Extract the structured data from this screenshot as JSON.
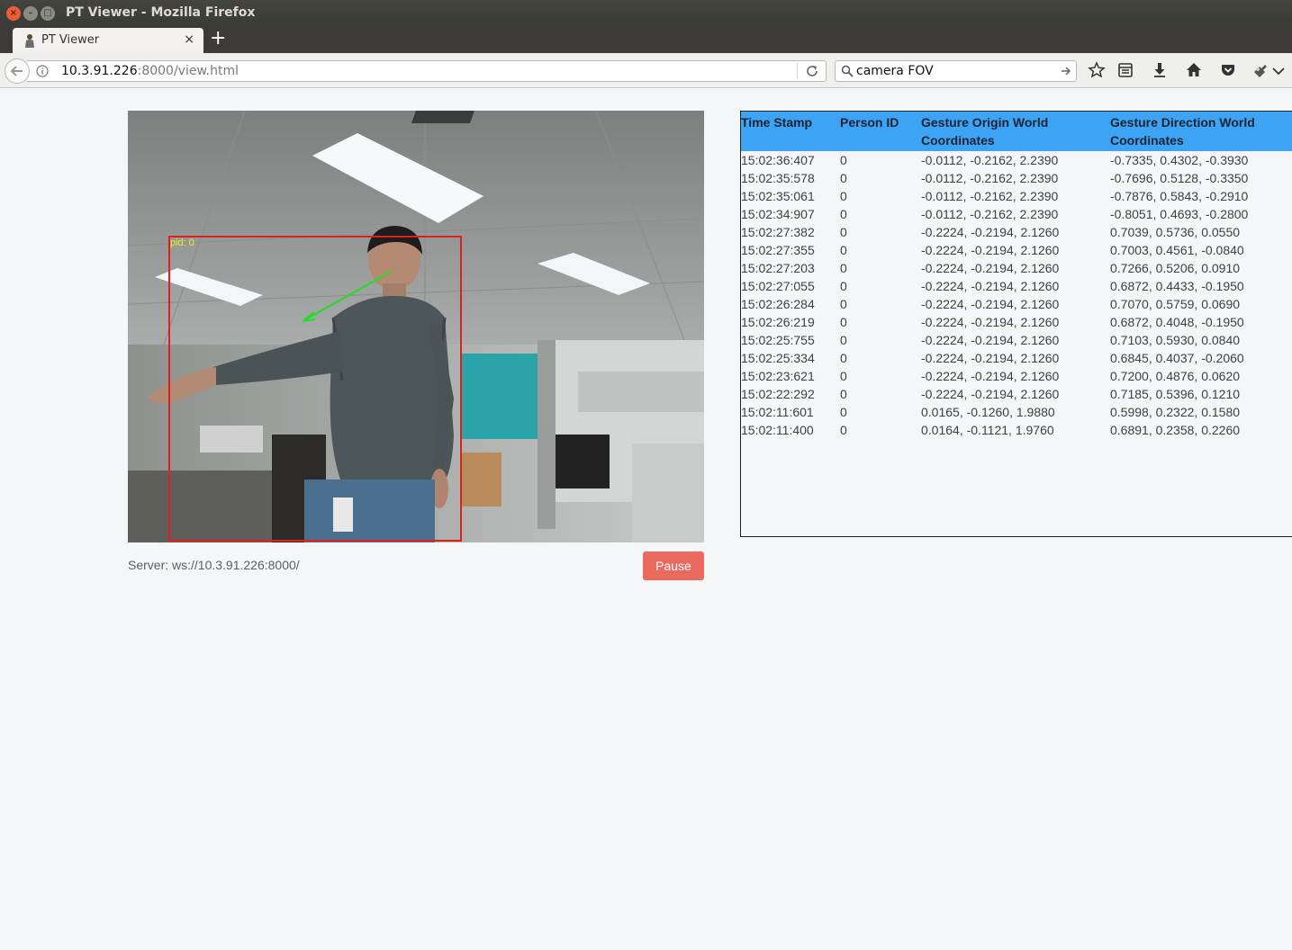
{
  "window": {
    "title": "PT Viewer - Mozilla Firefox"
  },
  "tab": {
    "label": "PT Viewer",
    "close": "×"
  },
  "newtab": {
    "label": "+"
  },
  "url": {
    "host": "10.3.91.226",
    "rest": ":8000/view.html"
  },
  "search": {
    "value": "camera FOV"
  },
  "toolbar": {
    "icons": [
      "bookmark-star-icon",
      "reading-list-icon",
      "downloads-icon",
      "home-icon",
      "pocket-icon",
      "extension-icon",
      "menu-chevron-icon"
    ]
  },
  "video": {
    "overlay_label": "pid: 0"
  },
  "server": {
    "status": "Server: ws://10.3.91.226:8000/"
  },
  "controls": {
    "pause_label": "Pause"
  },
  "table": {
    "headers": [
      "Time Stamp",
      "Person ID",
      "Gesture Origin World Coordinates",
      "Gesture Direction World Coordinates"
    ],
    "rows": [
      [
        "15:02:36:407",
        "0",
        "-0.0112, -0.2162, 2.2390",
        "-0.7335, 0.4302, -0.3930"
      ],
      [
        "15:02:35:578",
        "0",
        "-0.0112, -0.2162, 2.2390",
        "-0.7696, 0.5128, -0.3350"
      ],
      [
        "15:02:35:061",
        "0",
        "-0.0112, -0.2162, 2.2390",
        "-0.7876, 0.5843, -0.2910"
      ],
      [
        "15:02:34:907",
        "0",
        "-0.0112, -0.2162, 2.2390",
        "-0.8051, 0.4693, -0.2800"
      ],
      [
        "15:02:27:382",
        "0",
        "-0.2224, -0.2194, 2.1260",
        "0.7039, 0.5736, 0.0550"
      ],
      [
        "15:02:27:355",
        "0",
        "-0.2224, -0.2194, 2.1260",
        "0.7003, 0.4561, -0.0840"
      ],
      [
        "15:02:27:203",
        "0",
        "-0.2224, -0.2194, 2.1260",
        "0.7266, 0.5206, 0.0910"
      ],
      [
        "15:02:27:055",
        "0",
        "-0.2224, -0.2194, 2.1260",
        "0.6872, 0.4433, -0.1950"
      ],
      [
        "15:02:26:284",
        "0",
        "-0.2224, -0.2194, 2.1260",
        "0.7070, 0.5759, 0.0690"
      ],
      [
        "15:02:26:219",
        "0",
        "-0.2224, -0.2194, 2.1260",
        "0.6872, 0.4048, -0.1950"
      ],
      [
        "15:02:25:755",
        "0",
        "-0.2224, -0.2194, 2.1260",
        "0.7103, 0.5930, 0.0840"
      ],
      [
        "15:02:25:334",
        "0",
        "-0.2224, -0.2194, 2.1260",
        "0.6845, 0.4037, -0.2060"
      ],
      [
        "15:02:23:621",
        "0",
        "-0.2224, -0.2194, 2.1260",
        "0.7200, 0.4876, 0.0620"
      ],
      [
        "15:02:22:292",
        "0",
        "-0.2224, -0.2194, 2.1260",
        "0.7185, 0.5396, 0.1210"
      ],
      [
        "15:02:11:601",
        "0",
        "0.0165, -0.1260, 1.9880",
        "0.5998, 0.2322, 0.1580"
      ],
      [
        "15:02:11:400",
        "0",
        "0.0164, -0.1121, 1.9760",
        "0.6891, 0.2358, 0.2260"
      ]
    ]
  },
  "colors": {
    "header_bg": "#3da3f5",
    "pause_bg": "#ea6a60",
    "bbox": "#e02020",
    "arrow": "#22dd22",
    "label": "#f0f020"
  }
}
